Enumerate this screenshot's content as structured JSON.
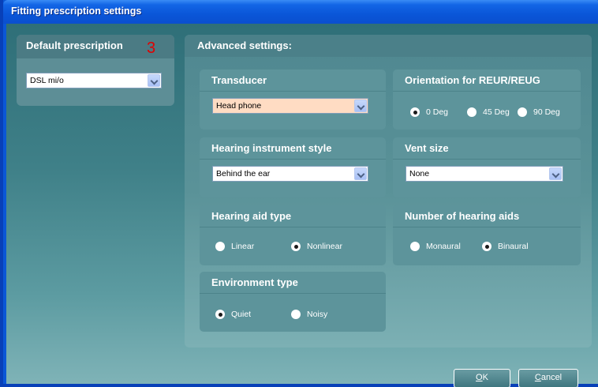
{
  "window": {
    "title": "Fitting prescription settings"
  },
  "default_prescription": {
    "title": "Default prescription",
    "annotation": "3",
    "selected": "DSL mi/o"
  },
  "advanced": {
    "title": "Advanced settings:",
    "transducer": {
      "title": "Transducer",
      "selected": "Head phone"
    },
    "orientation": {
      "title": "Orientation for REUR/REUG",
      "options": [
        {
          "label": "0 Deg",
          "checked": true
        },
        {
          "label": "45 Deg",
          "checked": false
        },
        {
          "label": "90 Deg",
          "checked": false
        }
      ]
    },
    "hi_style": {
      "title": "Hearing instrument style",
      "selected": "Behind the ear"
    },
    "vent_size": {
      "title": "Vent size",
      "selected": "None"
    },
    "aid_type": {
      "title": "Hearing aid type",
      "options": [
        {
          "label": "Linear",
          "checked": false
        },
        {
          "label": "Nonlinear",
          "checked": true
        }
      ]
    },
    "num_aids": {
      "title": "Number of hearing aids",
      "options": [
        {
          "label": "Monaural",
          "checked": false
        },
        {
          "label": "Binaural",
          "checked": true
        }
      ]
    },
    "environment": {
      "title": "Environment type",
      "options": [
        {
          "label": "Quiet",
          "checked": true
        },
        {
          "label": "Noisy",
          "checked": false
        }
      ]
    }
  },
  "buttons": {
    "ok": {
      "mnemonic": "O",
      "rest": "K"
    },
    "cancel": {
      "mnemonic": "C",
      "rest": "ancel"
    }
  }
}
